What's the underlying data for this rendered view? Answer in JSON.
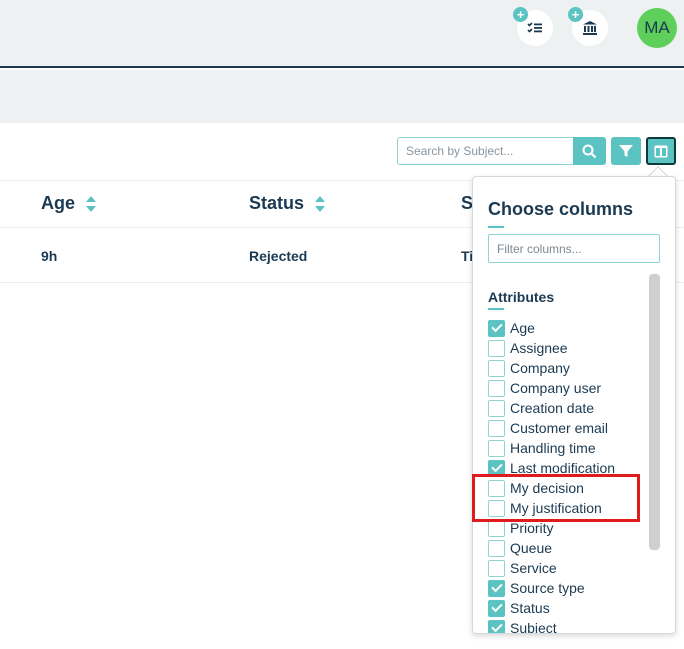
{
  "header": {
    "avatar_initials": "MA",
    "tasks_icon": "add-task-list-icon",
    "bank_icon": "add-institution-icon"
  },
  "toolbar": {
    "search_placeholder": "Search by Subject...",
    "search_icon": "search-icon",
    "filter_icon": "filter-icon",
    "columns_icon": "columns-icon"
  },
  "table": {
    "columns": [
      "Age",
      "Status",
      "S"
    ],
    "rows": [
      [
        "9h",
        "Rejected",
        "Ti"
      ]
    ]
  },
  "column_chooser": {
    "title": "Choose columns",
    "filter_placeholder": "Filter columns...",
    "section_title": "Attributes",
    "options": [
      {
        "label": "Age",
        "checked": true
      },
      {
        "label": "Assignee",
        "checked": false
      },
      {
        "label": "Company",
        "checked": false
      },
      {
        "label": "Company user",
        "checked": false
      },
      {
        "label": "Creation date",
        "checked": false
      },
      {
        "label": "Customer email",
        "checked": false
      },
      {
        "label": "Handling time",
        "checked": false
      },
      {
        "label": "Last modification",
        "checked": true
      },
      {
        "label": "My decision",
        "checked": false
      },
      {
        "label": "My justification",
        "checked": false
      },
      {
        "label": "Priority",
        "checked": false
      },
      {
        "label": "Queue",
        "checked": false
      },
      {
        "label": "Service",
        "checked": false
      },
      {
        "label": "Source type",
        "checked": true
      },
      {
        "label": "Status",
        "checked": true
      },
      {
        "label": "Subject",
        "checked": true
      }
    ]
  },
  "colors": {
    "accent": "#5cc3c3",
    "navy": "#1b3a52",
    "avatar": "#5ecf5a",
    "highlight": "#e01b1b"
  }
}
